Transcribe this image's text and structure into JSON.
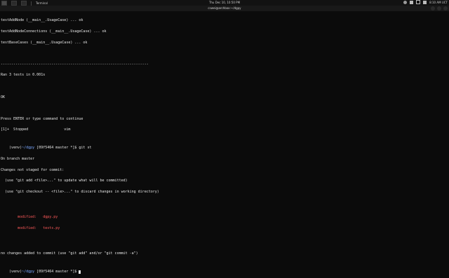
{
  "desktop_bar": {
    "app_label": "Terminal",
    "datetime": "Thu Dec 10, 10:50 PM",
    "time_right": "8:10 AM UCT"
  },
  "window": {
    "title": "cswei@archbox:~/dgpy"
  },
  "terminal": {
    "lines": [
      "testAddNode (__main__.UsageCase) ... ok",
      "testAddNodeConnections (__main__.UsageCase) ... ok",
      "testBaseCases (__main__.UsageCase) ... ok",
      "",
      "----------------------------------------------------------------------",
      "Ran 3 tests in 0.001s",
      "",
      "OK",
      "",
      "Press ENTER or type command to continue",
      "[1]+  Stopped                 vim",
      "(venv)~/dgpy [09f5464 master *]$ git st",
      "On branch master",
      "Changes not staged for commit:",
      "  (use \"git add <file>...\" to update what will be committed)",
      "  (use \"git checkout -- <file>...\" to discard changes in working directory)",
      "",
      "        modified:   dgpy.py",
      "        modified:   tests.py",
      "",
      "no changes added to commit (use \"git add\" and/or \"git commit -a\")",
      "(venv)~/dgpy [09f5464 master *]$ "
    ],
    "prompt_prefix": "(venv)",
    "prompt_path": "~/dgpy",
    "prompt_git": "[09f5464 master *]",
    "prompt_suffix": "$ ",
    "cmd": "git st",
    "modified_1": "modified:   dgpy.py",
    "modified_2": "modified:   tests.py"
  }
}
